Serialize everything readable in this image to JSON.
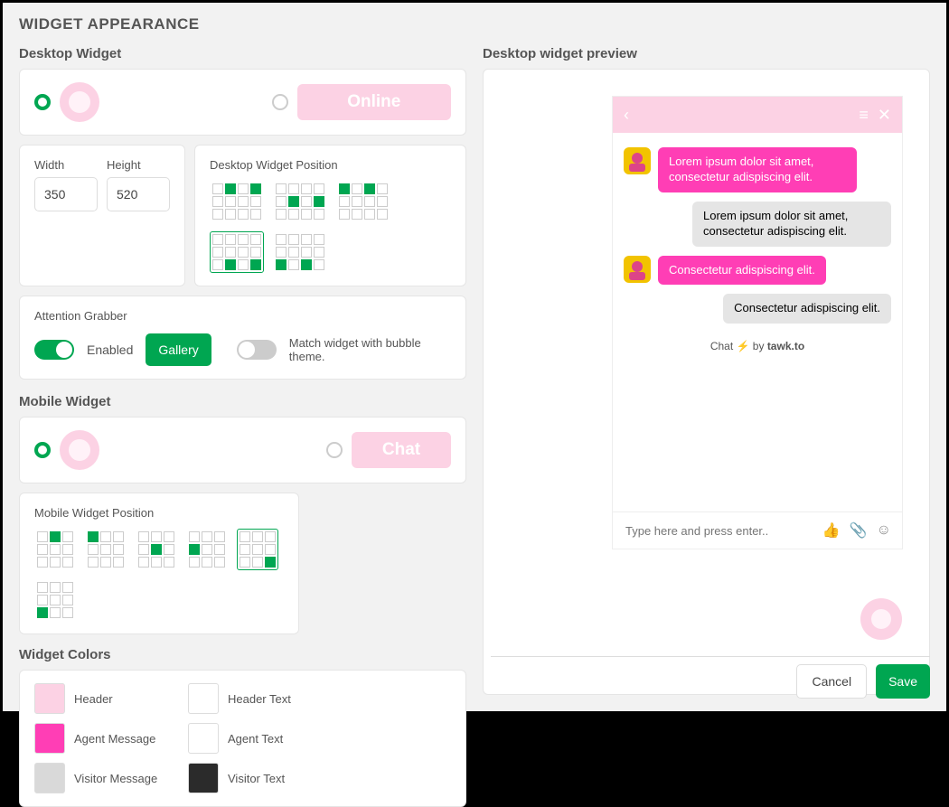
{
  "title": "WIDGET APPEARANCE",
  "desktop": {
    "label": "Desktop Widget",
    "online_label": "Online",
    "width_label": "Width",
    "height_label": "Height",
    "width": "350",
    "height": "520",
    "position_label": "Desktop Widget Position"
  },
  "attention": {
    "label": "Attention Grabber",
    "enabled_label": "Enabled",
    "gallery_label": "Gallery",
    "match_label": "Match widget with bubble theme."
  },
  "mobile": {
    "label": "Mobile Widget",
    "chat_label": "Chat",
    "position_label": "Mobile Widget Position"
  },
  "colors": {
    "label": "Widget Colors",
    "items": [
      {
        "name": "Header",
        "hex": "#fcd2e4"
      },
      {
        "name": "Header Text",
        "hex": "#ffffff"
      },
      {
        "name": "Agent Message",
        "hex": "#ff3eb5"
      },
      {
        "name": "Agent Text",
        "hex": "#ffffff"
      },
      {
        "name": "Visitor Message",
        "hex": "#d9d9d9"
      },
      {
        "name": "Visitor Text",
        "hex": "#2b2b2b"
      }
    ]
  },
  "preview": {
    "label": "Desktop widget preview",
    "msg1": "Lorem ipsum dolor sit amet, consectetur adispiscing elit.",
    "msg2": "Lorem ipsum dolor sit amet, consectetur adispiscing elit.",
    "msg3": "Consectetur adispiscing elit.",
    "msg4": "Consectetur adispiscing elit.",
    "powered_prefix": "Chat ",
    "powered_by": " by ",
    "powered_brand": "tawk.to",
    "placeholder": "Type here and press enter.."
  },
  "buttons": {
    "cancel": "Cancel",
    "save": "Save"
  }
}
